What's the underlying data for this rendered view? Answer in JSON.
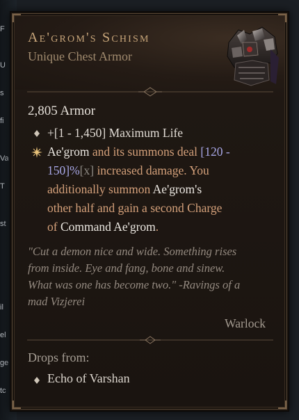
{
  "background": {
    "fragments": [
      "F",
      "U",
      "s",
      "fi",
      "Va",
      "T",
      "st",
      "il",
      "el",
      "ge",
      "tc"
    ]
  },
  "item": {
    "name": "Ae'grom's Schism",
    "type": "Unique Chest Armor",
    "icon": "chest-armor-icon",
    "armor": "2,805 Armor"
  },
  "affixes": {
    "life": {
      "text": "+[1 - 1,450] Maximum Life"
    },
    "unique": {
      "lines": [
        [
          {
            "t": "Ae'grom",
            "c": "white"
          },
          {
            "t": " and its summons deal ",
            "c": "orange"
          },
          {
            "t": "[120 -",
            "c": "purple"
          }
        ],
        [
          {
            "t": "150]%",
            "c": "purple"
          },
          {
            "t": "[x]",
            "c": "grey"
          },
          {
            "t": " increased damage. You",
            "c": "orange"
          }
        ],
        [
          {
            "t": "additionally summon ",
            "c": "orange"
          },
          {
            "t": "Ae'grom's",
            "c": "white"
          }
        ],
        [
          {
            "t": "other half and gain a second Charge",
            "c": "orange"
          }
        ],
        [
          {
            "t": "of ",
            "c": "orange"
          },
          {
            "t": "Command Ae'grom",
            "c": "white"
          },
          {
            "t": ".",
            "c": "orange"
          }
        ]
      ]
    }
  },
  "flavor": {
    "lines": [
      "\"Cut a demon nice and wide. Something rises",
      "from inside. Eye and fang, bone and sinew.",
      "What was one has become two.\" -Ravings of a",
      "mad Vizjerei"
    ]
  },
  "class_requirement": "Warlock",
  "drops": {
    "label": "Drops from:",
    "sources": [
      "Echo of Varshan"
    ]
  },
  "colors": {
    "title": "#c9a77b",
    "subtitle": "#a08a6e",
    "affix_orange": "#d4a07a",
    "affix_purple": "#a8a7e6",
    "range_grey": "#8e8a84",
    "flavor": "#948a80"
  }
}
